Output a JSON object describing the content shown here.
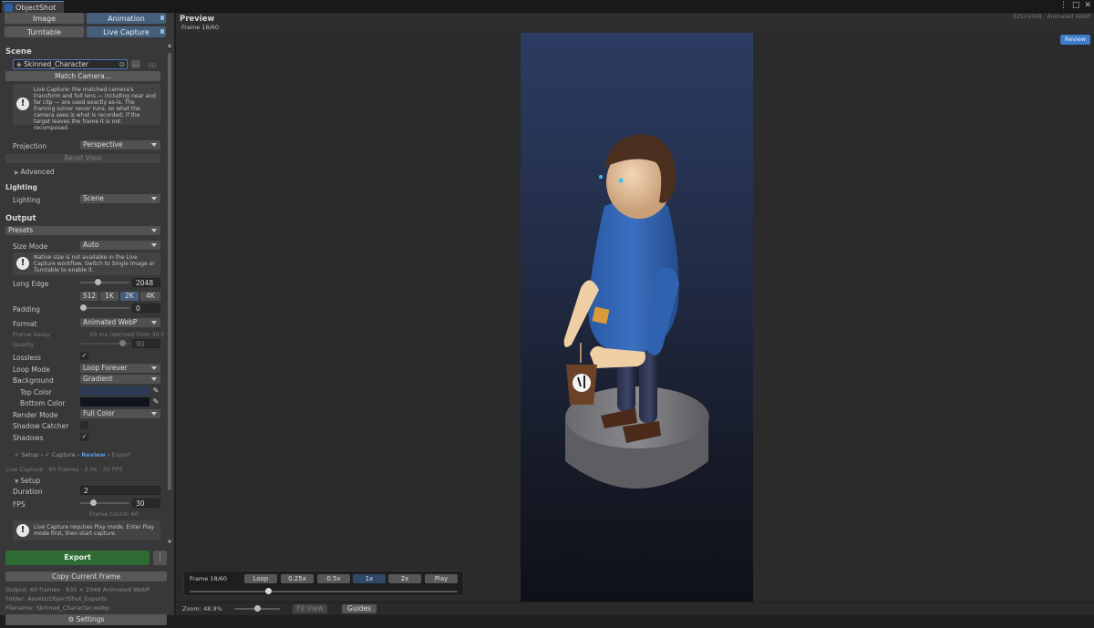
{
  "window": {
    "tab_title": "ObjectShot",
    "controls": [
      "⋮",
      "□",
      "✕"
    ]
  },
  "modes": {
    "image": "Image",
    "animation": "Animation",
    "turntable": "Turntable",
    "live_capture": "Live Capture"
  },
  "scene": {
    "header": "Scene",
    "object": "Skinned_Character",
    "tag": "3D",
    "match_camera": "Match Camera...",
    "help": "Live Capture: the matched camera's transform and full lens — including near and far clip — are used exactly as-is. The framing solver never runs, so what the camera sees is what is recorded; if the target leaves the frame it is not recomposed.",
    "projection_label": "Projection",
    "projection_value": "Perspective",
    "reset_view": "Reset View",
    "advanced": "Advanced"
  },
  "lighting": {
    "header": "Lighting",
    "label": "Lighting",
    "value": "Scene"
  },
  "output": {
    "header": "Output",
    "presets": "Presets",
    "size_mode_label": "Size Mode",
    "size_mode_value": "Auto",
    "size_help": "Native size is not available in the Live Capture workflow. Switch to Single Image or Turntable to enable it.",
    "long_edge_label": "Long Edge",
    "long_edge_value": "2048",
    "long_edge_fraction": 0.35,
    "size_presets": [
      "512",
      "1K",
      "2K",
      "4K"
    ],
    "size_preset_active": "2K",
    "padding_label": "Padding",
    "padding_value": "0",
    "format_label": "Format",
    "format_value": "Animated WebP",
    "frame_delay_label": "Frame Delay",
    "frame_delay_value": "33 ms (derived from 30 F",
    "quality_label": "Quality",
    "quality_value": "90",
    "lossless_label": "Lossless",
    "loop_mode_label": "Loop Mode",
    "loop_mode_value": "Loop Forever",
    "background_label": "Background",
    "background_value": "Gradient",
    "top_color_label": "Top Color",
    "bottom_color_label": "Bottom Color",
    "top_color": "#2d3b57",
    "bottom_color": "#10141c",
    "render_mode_label": "Render Mode",
    "render_mode_value": "Full Color",
    "shadow_catcher_label": "Shadow Catcher",
    "shadows_label": "Shadows"
  },
  "steps": {
    "setup": "✓ Setup",
    "capture": "✓ Capture",
    "review": "Review",
    "export": "Export",
    "sep": "›"
  },
  "capture_info": "Live Capture · 60 frames · 2.0s · 30 FPS",
  "setup": {
    "header": "Setup",
    "duration_label": "Duration",
    "duration_value": "2",
    "fps_label": "FPS",
    "fps_value": "30",
    "frame_count": "Frame Count: 60",
    "help": "Live Capture requires Play mode. Enter Play mode first, then start capture."
  },
  "actions": {
    "export": "Export",
    "more": "⋮",
    "copy_frame": "Copy Current Frame",
    "output_info": "Output: 60 frames · 835 × 2048 Animated WebP",
    "folder": "Folder: Assets/ObjectShot_Exports",
    "filename": "Filename: Skinned_Character.webp",
    "settings": "Settings"
  },
  "preview": {
    "title": "Preview",
    "frame": "Frame 18/60",
    "meta": "835×2048 · Animated WebP",
    "review_btn": "Review"
  },
  "playbar": {
    "frame": "Frame 18/60",
    "loop": "Loop",
    "speeds": [
      "0.25x",
      "0.5x",
      "1x",
      "2x"
    ],
    "active_speed": "1x",
    "play": "Play",
    "progress": 0.29
  },
  "bottombar": {
    "zoom": "Zoom: 48.9%",
    "zoom_fraction": 0.5,
    "fit_view": "Fit View",
    "guides": "Guides"
  },
  "colors": {
    "accent": "#46607c",
    "export_green": "#2f6b35",
    "review_blue": "#3d7cc9"
  }
}
